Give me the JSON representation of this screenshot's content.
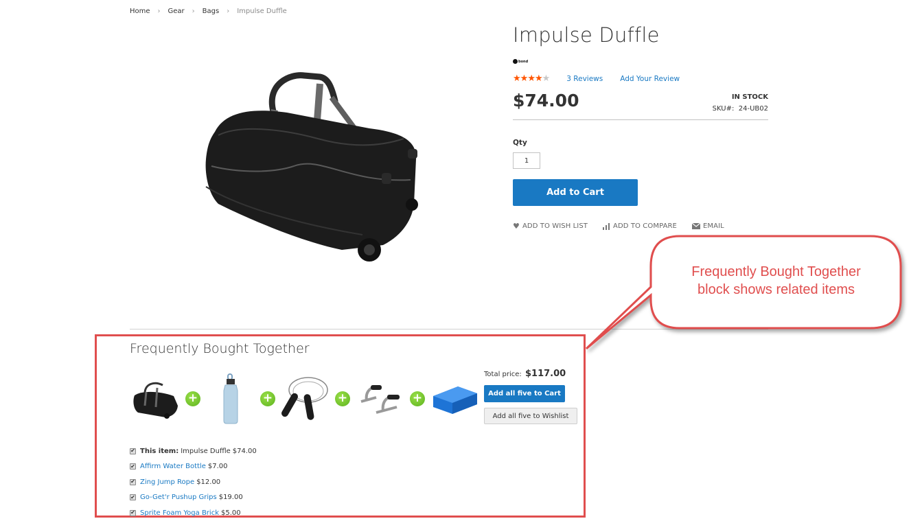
{
  "breadcrumb": {
    "items": [
      "Home",
      "Gear",
      "Bags"
    ],
    "current": "Impulse Duffle",
    "separator": ">"
  },
  "product": {
    "title": "Impulse Duffle",
    "brand": "bond",
    "rating": {
      "stars_filled": 4,
      "stars_total": 5
    },
    "reviews_label": "3 Reviews",
    "add_review_label": "Add Your Review",
    "price": "$74.00",
    "stock": "IN STOCK",
    "sku_label": "SKU#:",
    "sku": "24-UB02",
    "qty_label": "Qty",
    "qty_value": "1",
    "add_to_cart_label": "Add to Cart",
    "actions": [
      {
        "icon": "heart-icon",
        "label": "ADD TO WISH LIST"
      },
      {
        "icon": "compare-icon",
        "label": "ADD TO COMPARE"
      },
      {
        "icon": "envelope-icon",
        "label": "EMAIL"
      }
    ]
  },
  "fbt": {
    "title": "Frequently Bought Together",
    "thumbnails": [
      "duffle-bag",
      "water-bottle",
      "jump-rope",
      "pushup-grips",
      "yoga-brick"
    ],
    "total_label": "Total price:",
    "total_value": "$117.00",
    "add_all_cart_label": "Add all five to Cart",
    "add_all_wishlist_label": "Add all five to Wishlist",
    "items": [
      {
        "prefix": "This item:",
        "name": "Impulse Duffle",
        "price": "$74.00",
        "checked": true,
        "is_link": false
      },
      {
        "prefix": "",
        "name": "Affirm Water Bottle",
        "price": "$7.00",
        "checked": true,
        "is_link": true
      },
      {
        "prefix": "",
        "name": "Zing Jump Rope",
        "price": "$12.00",
        "checked": true,
        "is_link": true
      },
      {
        "prefix": "",
        "name": "Go-Get'r Pushup Grips",
        "price": "$19.00",
        "checked": true,
        "is_link": true
      },
      {
        "prefix": "",
        "name": "Sprite Foam Yoga Brick",
        "price": "$5.00",
        "checked": true,
        "is_link": true
      }
    ]
  },
  "annotation": {
    "line1": "Frequently Bought Together",
    "line2": "block shows related items",
    "color": "#e04e4e"
  },
  "colors": {
    "accent": "#1979c3",
    "star": "#ff5501",
    "annotation": "#e04e4e"
  }
}
